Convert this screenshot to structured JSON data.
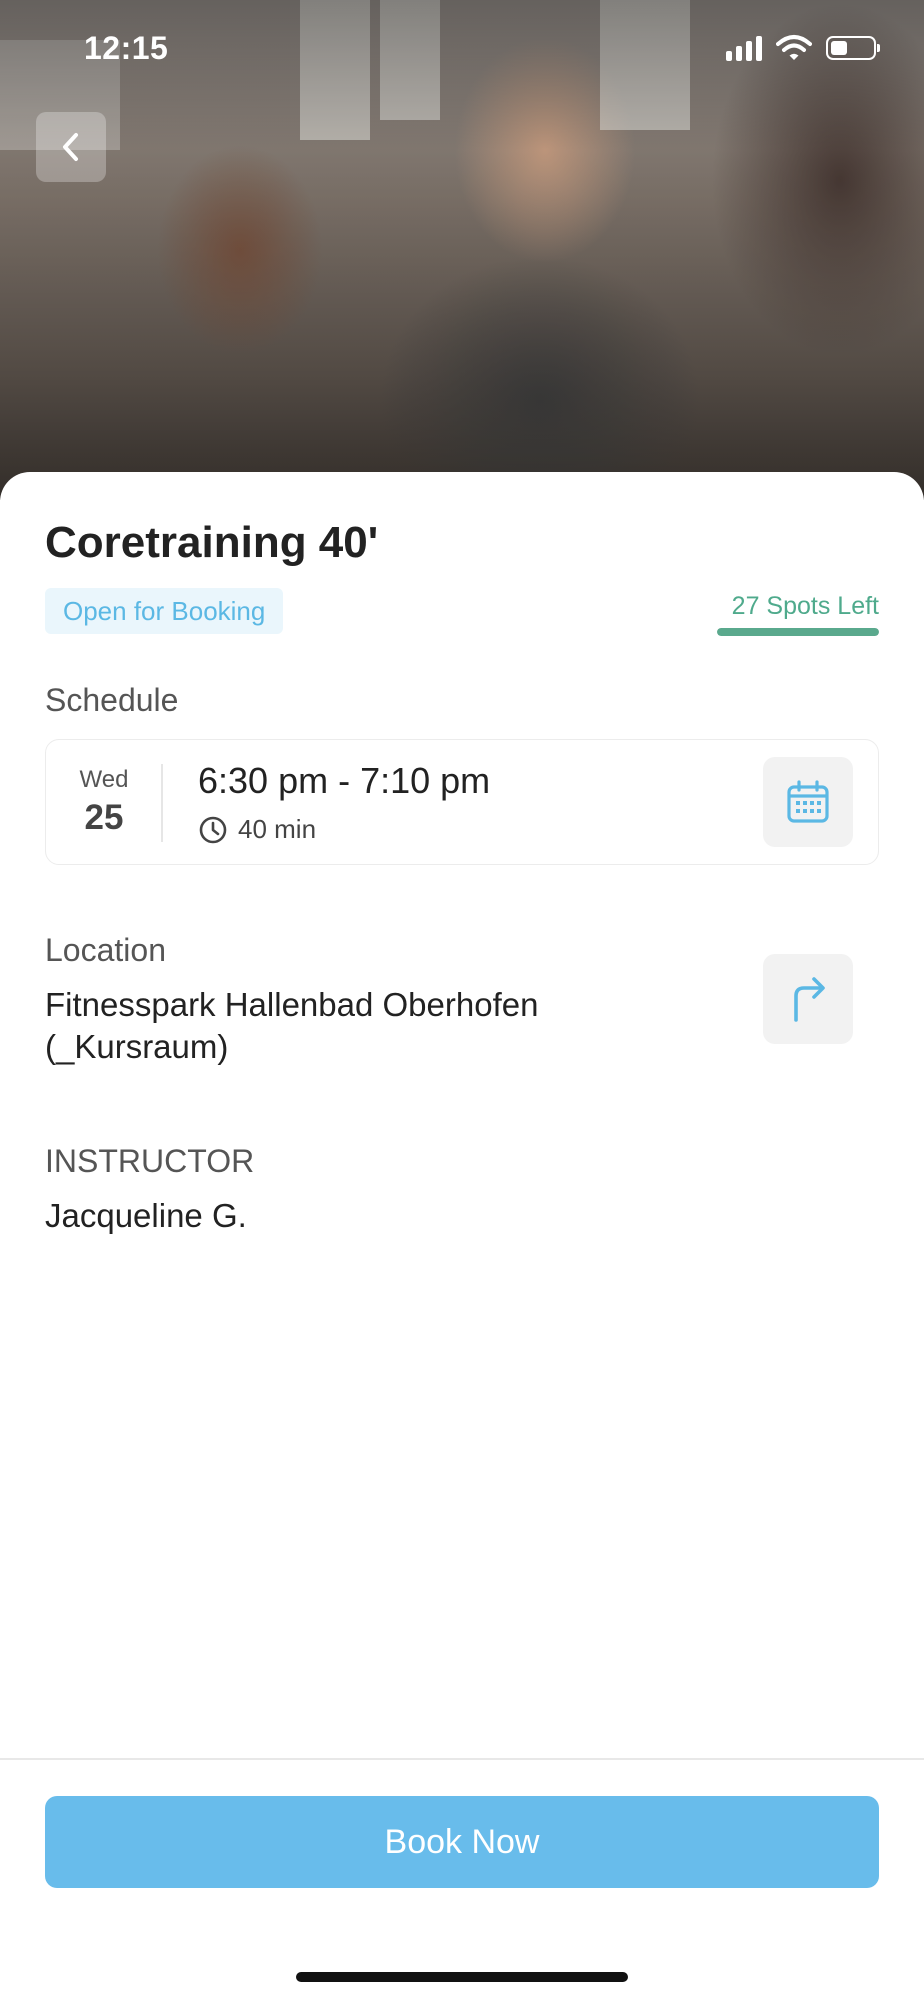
{
  "status_bar": {
    "time": "12:15"
  },
  "header": {
    "back_icon": "chevron-left-icon"
  },
  "class": {
    "title": "Coretraining 40'",
    "status_badge": "Open for Booking",
    "spots_left": "27 Spots Left",
    "spots_fill_fraction": 1.0
  },
  "schedule": {
    "label": "Schedule",
    "day_of_week": "Wed",
    "day_of_month": "25",
    "time_range": "6:30 pm - 7:10 pm",
    "duration": "40 min",
    "calendar_icon": "calendar-icon"
  },
  "location": {
    "label": "Location",
    "line1": "Fitnesspark Hallenbad Oberhofen",
    "line2": "(_Kursraum)",
    "directions_icon": "directions-arrow-icon"
  },
  "instructor": {
    "label": "INSTRUCTOR",
    "name": "Jacqueline G."
  },
  "actions": {
    "book_label": "Book Now"
  },
  "colors": {
    "accent": "#68bceb",
    "badge_text": "#5bb8e4",
    "spots": "#4faa8c"
  }
}
